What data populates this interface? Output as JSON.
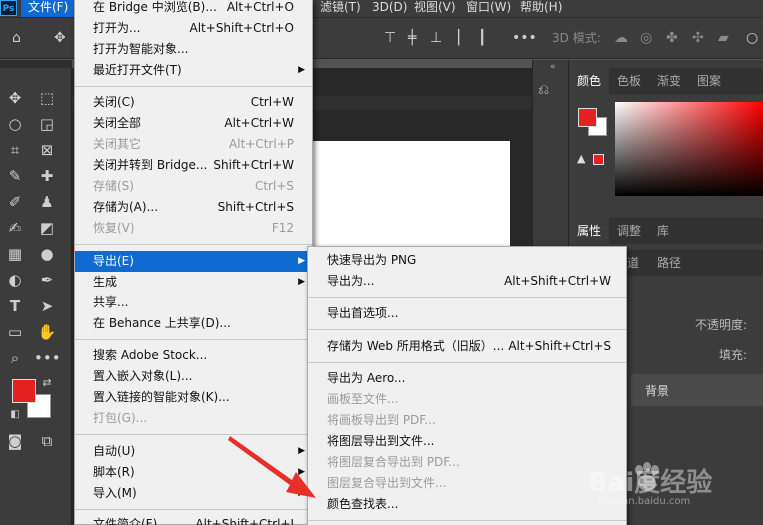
{
  "app": {
    "logo": "Ps"
  },
  "menubar": {
    "file": "文件(F)",
    "filter": "滤镜(T)",
    "threed": "3D(D)",
    "view": "视图(V)",
    "window": "窗口(W)",
    "help": "帮助(H)"
  },
  "options": {
    "mode3d": "3D 模式:"
  },
  "panels": {
    "color_tabs": [
      "颜色",
      "色板",
      "渐变",
      "图案"
    ],
    "props_tabs": [
      "属性",
      "调整",
      "库"
    ],
    "layers_tabs": [
      "道",
      "路径"
    ],
    "opacity_label": "不透明度:",
    "fill_label": "填充:",
    "layer_name": "背景"
  },
  "file_menu": {
    "items": [
      {
        "label": "在 Bridge 中浏览(B)...",
        "shortcut": "Alt+Ctrl+O"
      },
      {
        "label": "打开为...",
        "shortcut": "Alt+Shift+Ctrl+O"
      },
      {
        "label": "打开为智能对象..."
      },
      {
        "label": "最近打开文件(T)",
        "submenu": true
      },
      {
        "label": "关闭(C)",
        "shortcut": "Ctrl+W"
      },
      {
        "label": "关闭全部",
        "shortcut": "Alt+Ctrl+W"
      },
      {
        "label": "关闭其它",
        "shortcut": "Alt+Ctrl+P",
        "disabled": true
      },
      {
        "label": "关闭并转到 Bridge...",
        "shortcut": "Shift+Ctrl+W"
      },
      {
        "label": "存储(S)",
        "shortcut": "Ctrl+S",
        "disabled": true
      },
      {
        "label": "存储为(A)...",
        "shortcut": "Shift+Ctrl+S"
      },
      {
        "label": "恢复(V)",
        "shortcut": "F12",
        "disabled": true
      },
      {
        "label": "导出(E)",
        "submenu": true,
        "highlighted": true
      },
      {
        "label": "生成",
        "submenu": true
      },
      {
        "label": "共享..."
      },
      {
        "label": "在 Behance 上共享(D)..."
      },
      {
        "label": "搜索 Adobe Stock..."
      },
      {
        "label": "置入嵌入对象(L)..."
      },
      {
        "label": "置入链接的智能对象(K)..."
      },
      {
        "label": "打包(G)...",
        "disabled": true
      },
      {
        "label": "自动(U)",
        "submenu": true
      },
      {
        "label": "脚本(R)",
        "submenu": true
      },
      {
        "label": "导入(M)",
        "submenu": true
      },
      {
        "label": "文件简介(F)...",
        "shortcut": "Alt+Shift+Ctrl+I"
      }
    ]
  },
  "export_menu": {
    "items": [
      {
        "label": "快速导出为 PNG"
      },
      {
        "label": "导出为...",
        "shortcut": "Alt+Shift+Ctrl+W"
      },
      {
        "label": "导出首选项..."
      },
      {
        "label": "存储为 Web 所用格式（旧版）...",
        "shortcut": "Alt+Shift+Ctrl+S"
      },
      {
        "label": "导出为 Aero..."
      },
      {
        "label": "画板至文件...",
        "disabled": true
      },
      {
        "label": "将画板导出到 PDF...",
        "disabled": true
      },
      {
        "label": "将图层导出到文件..."
      },
      {
        "label": "将图层复合导出到 PDF...",
        "disabled": true
      },
      {
        "label": "图层复合导出到文件...",
        "disabled": true
      },
      {
        "label": "颜色查找表..."
      }
    ]
  },
  "watermark": {
    "text": "Bai度经验",
    "sub": "jingyan.baidu.com"
  },
  "colors": {
    "accent": "#0f6ad1",
    "foreground": "#e52222",
    "background": "#ffffff"
  }
}
